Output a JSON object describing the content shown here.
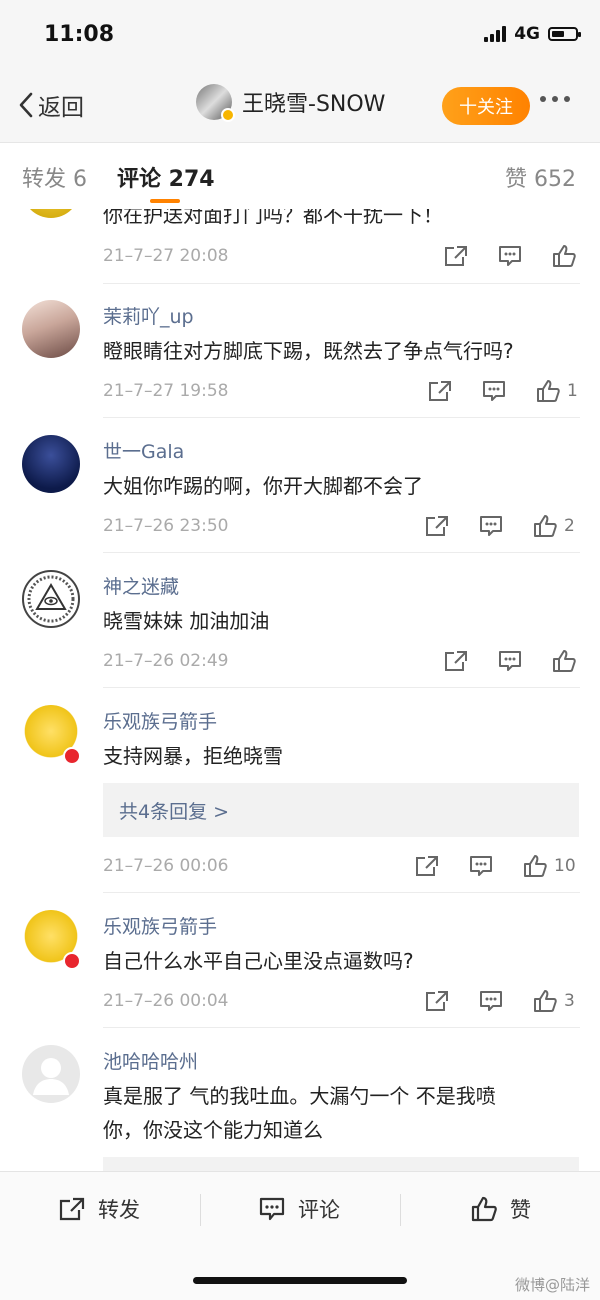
{
  "status": {
    "time": "11:08",
    "network": "4G"
  },
  "nav": {
    "back_label": "返回",
    "author_name": "王晓雪-SNOW",
    "follow_label": "十关注"
  },
  "tabs": {
    "repost": "转发 6",
    "comment": "评论 274",
    "like": "赞 652"
  },
  "comments": [
    {
      "text": "你在护送对面打门吗？都不干扰一下！",
      "time": "21–7–27 20:08",
      "likes": ""
    },
    {
      "name": "茉莉吖_up",
      "text": "瞪眼睛往对方脚底下踢，既然去了争点气行吗?",
      "time": "21–7–27 19:58",
      "likes": "1"
    },
    {
      "name": "世一Gala",
      "text": "大姐你咋踢的啊，你开大脚都不会了",
      "time": "21–7–26 23:50",
      "likes": "2"
    },
    {
      "name": "神之迷藏",
      "text": "晓雪妹妹 加油加油",
      "time": "21–7–26 02:49",
      "likes": ""
    },
    {
      "name": "乐观族弓箭手",
      "text": "支持网暴，拒绝晓雪",
      "reply": "共4条回复 >",
      "time": "21–7–26 00:06",
      "likes": "10"
    },
    {
      "name": "乐观族弓箭手",
      "text": "自己什么水平自己心里没点逼数吗?",
      "time": "21–7–26 00:04",
      "likes": "3"
    },
    {
      "name": "池哈哈哈州",
      "text1": "真是服了 气的我吐血。大漏勺一个 不是我喷",
      "text2": "你，你没这个能力知道么"
    }
  ],
  "bottom": {
    "repost": "转发",
    "comment": "评论",
    "like": "赞"
  },
  "watermark": "微博@陆洋",
  "colors": {
    "accent": "#ff8200",
    "name": "#5b6e8f",
    "reply_bg": "#f2f2f2"
  }
}
